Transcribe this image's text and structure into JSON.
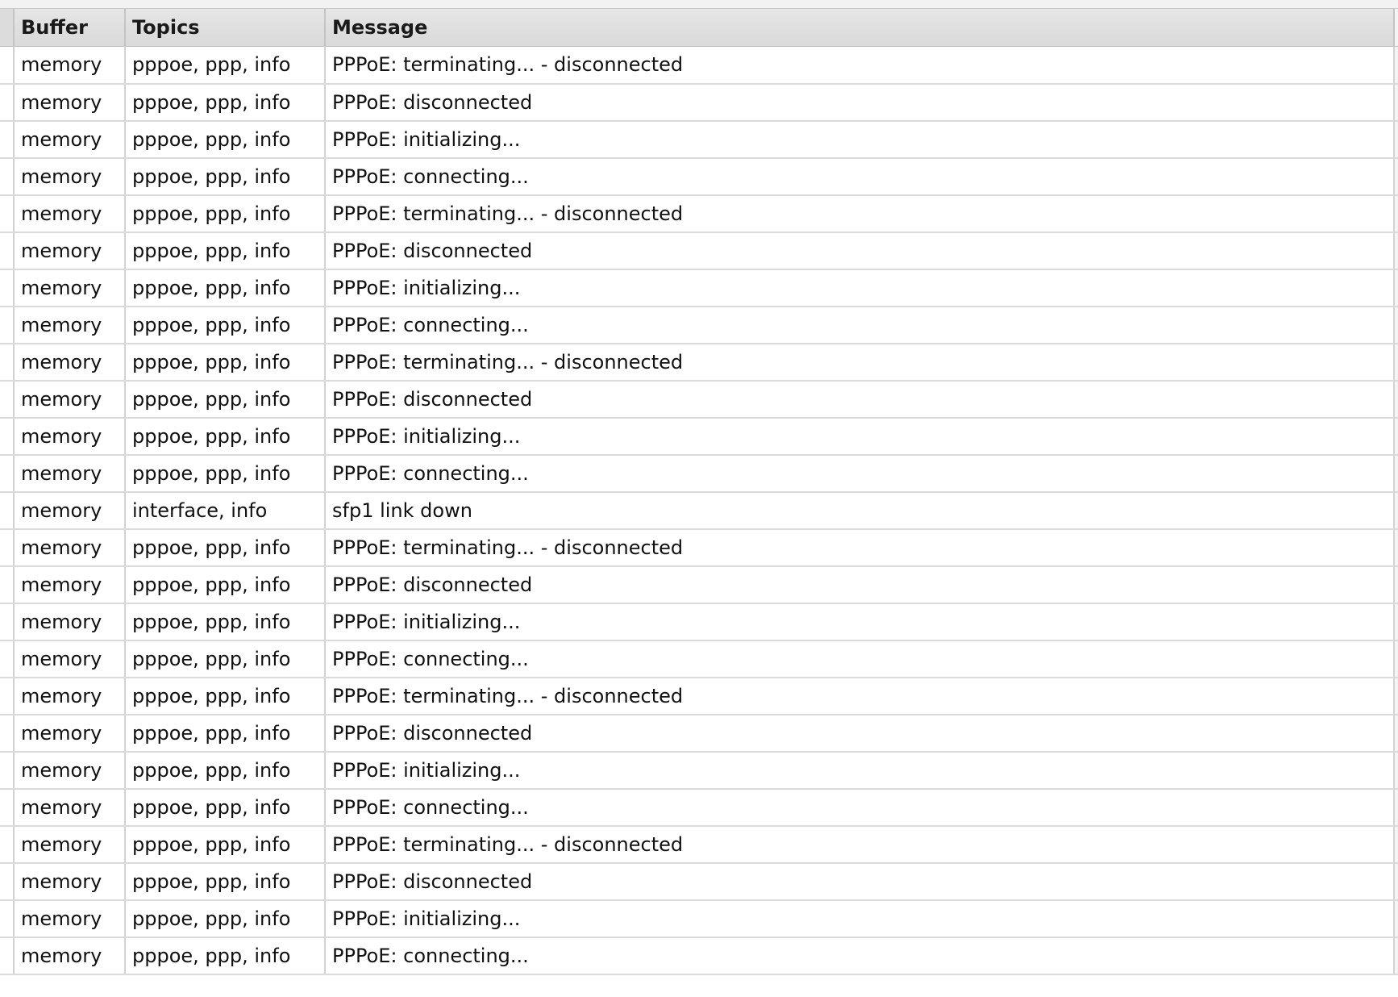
{
  "log_table": {
    "columns": [
      {
        "key": "buffer",
        "label": "Buffer"
      },
      {
        "key": "topics",
        "label": "Topics"
      },
      {
        "key": "message",
        "label": "Message"
      }
    ],
    "rows": [
      {
        "buffer": "memory",
        "topics": "pppoe, ppp, info",
        "message": "PPPoE: terminating... - disconnected"
      },
      {
        "buffer": "memory",
        "topics": "pppoe, ppp, info",
        "message": "PPPoE: disconnected"
      },
      {
        "buffer": "memory",
        "topics": "pppoe, ppp, info",
        "message": "PPPoE: initializing..."
      },
      {
        "buffer": "memory",
        "topics": "pppoe, ppp, info",
        "message": "PPPoE: connecting..."
      },
      {
        "buffer": "memory",
        "topics": "pppoe, ppp, info",
        "message": "PPPoE: terminating... - disconnected"
      },
      {
        "buffer": "memory",
        "topics": "pppoe, ppp, info",
        "message": "PPPoE: disconnected"
      },
      {
        "buffer": "memory",
        "topics": "pppoe, ppp, info",
        "message": "PPPoE: initializing..."
      },
      {
        "buffer": "memory",
        "topics": "pppoe, ppp, info",
        "message": "PPPoE: connecting..."
      },
      {
        "buffer": "memory",
        "topics": "pppoe, ppp, info",
        "message": "PPPoE: terminating... - disconnected"
      },
      {
        "buffer": "memory",
        "topics": "pppoe, ppp, info",
        "message": "PPPoE: disconnected"
      },
      {
        "buffer": "memory",
        "topics": "pppoe, ppp, info",
        "message": "PPPoE: initializing..."
      },
      {
        "buffer": "memory",
        "topics": "pppoe, ppp, info",
        "message": "PPPoE: connecting..."
      },
      {
        "buffer": "memory",
        "topics": "interface, info",
        "message": "sfp1 link down"
      },
      {
        "buffer": "memory",
        "topics": "pppoe, ppp, info",
        "message": "PPPoE: terminating... - disconnected"
      },
      {
        "buffer": "memory",
        "topics": "pppoe, ppp, info",
        "message": "PPPoE: disconnected"
      },
      {
        "buffer": "memory",
        "topics": "pppoe, ppp, info",
        "message": "PPPoE: initializing..."
      },
      {
        "buffer": "memory",
        "topics": "pppoe, ppp, info",
        "message": "PPPoE: connecting..."
      },
      {
        "buffer": "memory",
        "topics": "pppoe, ppp, info",
        "message": "PPPoE: terminating... - disconnected"
      },
      {
        "buffer": "memory",
        "topics": "pppoe, ppp, info",
        "message": "PPPoE: disconnected"
      },
      {
        "buffer": "memory",
        "topics": "pppoe, ppp, info",
        "message": "PPPoE: initializing..."
      },
      {
        "buffer": "memory",
        "topics": "pppoe, ppp, info",
        "message": "PPPoE: connecting..."
      },
      {
        "buffer": "memory",
        "topics": "pppoe, ppp, info",
        "message": "PPPoE: terminating... - disconnected"
      },
      {
        "buffer": "memory",
        "topics": "pppoe, ppp, info",
        "message": "PPPoE: disconnected"
      },
      {
        "buffer": "memory",
        "topics": "pppoe, ppp, info",
        "message": "PPPoE: initializing..."
      },
      {
        "buffer": "memory",
        "topics": "pppoe, ppp, info",
        "message": "PPPoE: connecting..."
      }
    ]
  }
}
